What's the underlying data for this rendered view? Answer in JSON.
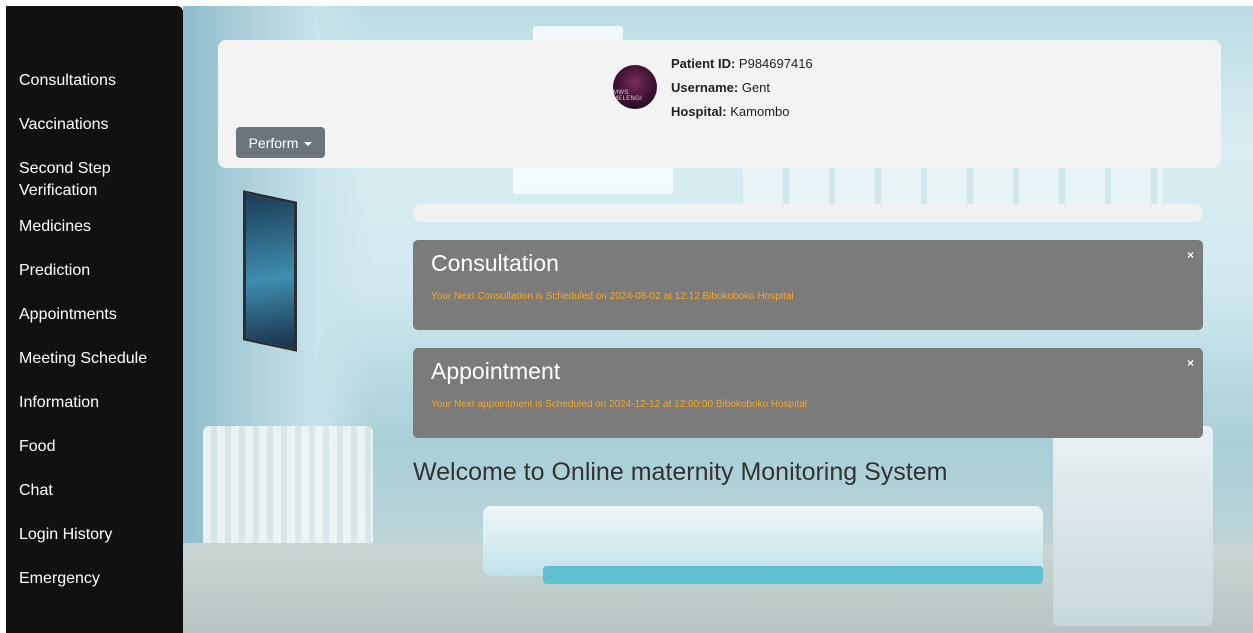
{
  "sidebar": {
    "items": [
      {
        "label": "Consultations"
      },
      {
        "label": "Vaccinations"
      },
      {
        "label": "Second Step Verification"
      },
      {
        "label": "Medicines"
      },
      {
        "label": "Prediction"
      },
      {
        "label": "Appointments"
      },
      {
        "label": "Meeting Schedule"
      },
      {
        "label": "Information"
      },
      {
        "label": "Food"
      },
      {
        "label": "Chat"
      },
      {
        "label": "Login History"
      },
      {
        "label": "Emergency"
      }
    ]
  },
  "header": {
    "avatar_text": "MWS MELENGI",
    "patient_id_label": "Patient ID:",
    "patient_id": "P984697416",
    "username_label": "Username:",
    "username": "Gent",
    "hospital_label": "Hospital:",
    "hospital": "Kamombo",
    "perform_button": "Perform"
  },
  "alerts": [
    {
      "title": "Consultation",
      "message": "Your Next Consultation is Scheduled on 2024-08-02 at 12:12 Bibokoboko Hospital",
      "close": "×"
    },
    {
      "title": "Appointment",
      "message": "Your Next appointment is Scheduled on 2024-12-12 at 12:00:00 Bibokoboko Hospital",
      "close": "×"
    }
  ],
  "welcome_text": "Welcome to Online maternity Monitoring System",
  "colors": {
    "sidebar_bg": "#111111",
    "alert_bg": "#7b7b7b",
    "alert_text": "#f5a623",
    "button_bg": "#6c757d"
  }
}
